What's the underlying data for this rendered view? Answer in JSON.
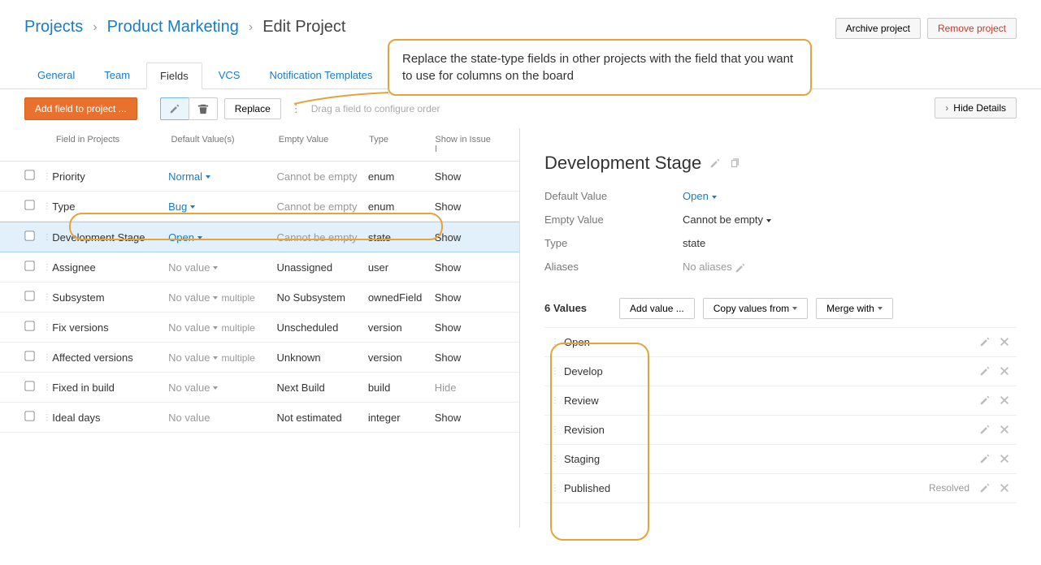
{
  "breadcrumb": {
    "projects": "Projects",
    "parent": "Product Marketing",
    "current": "Edit Project"
  },
  "topButtons": {
    "archive": "Archive project",
    "remove": "Remove project"
  },
  "tabs": [
    "General",
    "Team",
    "Fields",
    "VCS",
    "Notification Templates"
  ],
  "activeTab": 2,
  "toolbar": {
    "addField": "Add field to project ...",
    "replace": "Replace",
    "dragHint": "Drag a field to configure order",
    "hideDetails": "Hide Details"
  },
  "columns": {
    "field": "Field in Projects",
    "defaultVal": "Default Value(s)",
    "empty": "Empty Value",
    "type": "Type",
    "show": "Show in Issue l"
  },
  "fields": [
    {
      "name": "Priority",
      "defaultVal": "Normal",
      "defaultLink": true,
      "empty": "Cannot be empty",
      "emptyGray": true,
      "type": "enum",
      "show": "Show"
    },
    {
      "name": "Type",
      "defaultVal": "Bug",
      "defaultLink": true,
      "empty": "Cannot be empty",
      "emptyGray": true,
      "type": "enum",
      "show": "Show"
    },
    {
      "name": "Development Stage",
      "defaultVal": "Open",
      "defaultLink": true,
      "empty": "Cannot be empty",
      "emptyGray": true,
      "type": "state",
      "show": "Show",
      "selected": true
    },
    {
      "name": "Assignee",
      "defaultVal": "No value",
      "defaultLink": false,
      "empty": "Unassigned",
      "type": "user",
      "show": "Show"
    },
    {
      "name": "Subsystem",
      "defaultVal": "No value",
      "defaultLink": false,
      "multiple": true,
      "empty": "No Subsystem",
      "type": "ownedField",
      "show": "Show"
    },
    {
      "name": "Fix versions",
      "defaultVal": "No value",
      "defaultLink": false,
      "multiple": true,
      "empty": "Unscheduled",
      "type": "version",
      "show": "Show"
    },
    {
      "name": "Affected versions",
      "defaultVal": "No value",
      "defaultLink": false,
      "multiple": true,
      "empty": "Unknown",
      "type": "version",
      "show": "Show"
    },
    {
      "name": "Fixed in build",
      "defaultVal": "No value",
      "defaultLink": false,
      "empty": "Next Build",
      "type": "build",
      "show": "Hide",
      "showGray": true
    },
    {
      "name": "Ideal days",
      "defaultVal": "No value",
      "defaultLink": false,
      "noCaret": true,
      "empty": "Not estimated",
      "type": "integer",
      "show": "Show"
    }
  ],
  "detail": {
    "title": "Development Stage",
    "props": {
      "defaultLabel": "Default Value",
      "defaultValue": "Open",
      "emptyLabel": "Empty Value",
      "emptyValue": "Cannot be empty",
      "typeLabel": "Type",
      "typeValue": "state",
      "aliasesLabel": "Aliases",
      "aliasesValue": "No aliases"
    },
    "valuesCount": "6 Values",
    "buttons": {
      "addValue": "Add value ...",
      "copyFrom": "Copy values from",
      "mergeWith": "Merge with"
    },
    "values": [
      {
        "label": "Open"
      },
      {
        "label": "Develop"
      },
      {
        "label": "Review"
      },
      {
        "label": "Revision"
      },
      {
        "label": "Staging"
      },
      {
        "label": "Published",
        "resolved": "Resolved"
      }
    ]
  },
  "callout": "Replace the state-type fields in other projects with the field that you want to use for columns on the board",
  "multipleLabel": "multiple"
}
